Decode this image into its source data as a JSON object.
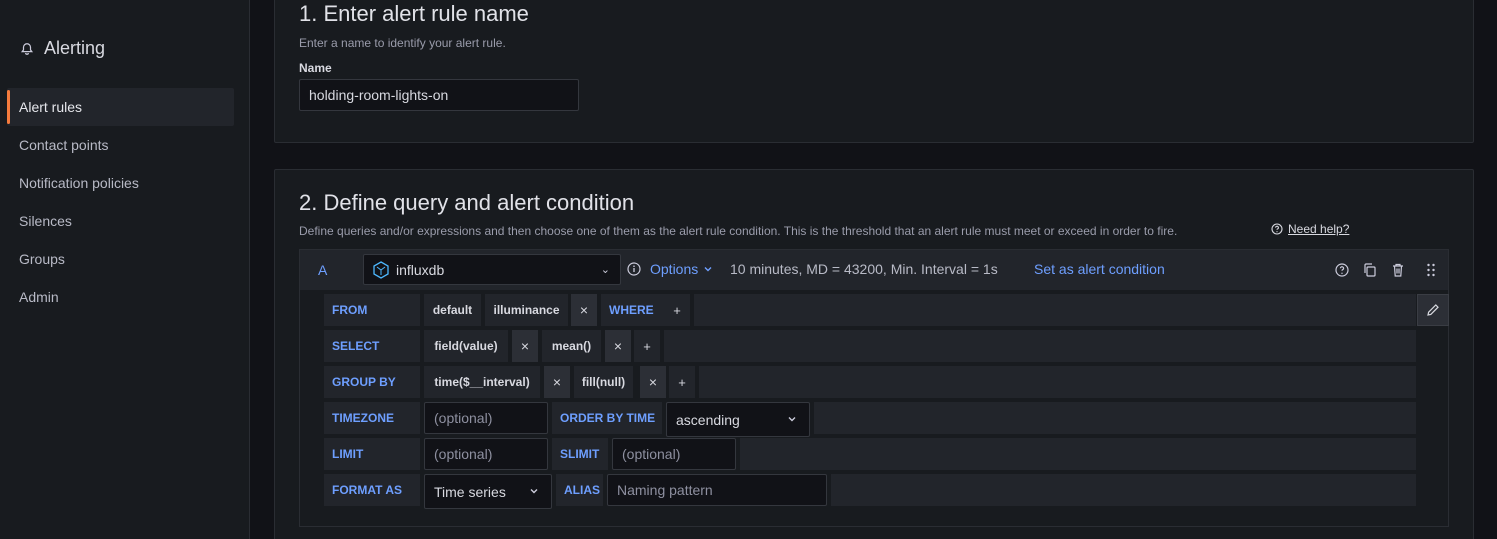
{
  "sidebar": {
    "title": "Alerting",
    "items": [
      {
        "label": "Alert rules",
        "active": true
      },
      {
        "label": "Contact points"
      },
      {
        "label": "Notification policies"
      },
      {
        "label": "Silences"
      },
      {
        "label": "Groups"
      },
      {
        "label": "Admin"
      }
    ]
  },
  "section1": {
    "heading": "1. Enter alert rule name",
    "description": "Enter a name to identify your alert rule.",
    "name_label": "Name",
    "name_value": "holding-room-lights-on"
  },
  "section2": {
    "heading": "2. Define query and alert condition",
    "description": "Define queries and/or expressions and then choose one of them as the alert rule condition. This is the threshold that an alert rule must meet or exceed in order to fire.",
    "help_link": "Need help?",
    "query": {
      "ref_id": "A",
      "datasource": "influxdb",
      "options_label": "Options",
      "options_summary": "10 minutes, MD = 43200, Min. Interval = 1s",
      "set_condition": "Set as alert condition",
      "from": {
        "keyword": "FROM",
        "policy": "default",
        "measurement": "illuminance",
        "where": "WHERE",
        "plus": "+"
      },
      "select": {
        "keyword": "SELECT",
        "field": "field(value)",
        "fn": "mean()",
        "plus": "+"
      },
      "group_by": {
        "keyword": "GROUP BY",
        "time": "time($__interval)",
        "fill": "fill(null)",
        "plus": "+"
      },
      "timezone": {
        "keyword": "TIMEZONE",
        "placeholder": "(optional)",
        "order_keyword": "ORDER BY TIME",
        "order_value": "ascending"
      },
      "limit": {
        "keyword": "LIMIT",
        "placeholder": "(optional)",
        "slimit_keyword": "SLIMIT",
        "slimit_placeholder": "(optional)"
      },
      "format": {
        "keyword": "FORMAT AS",
        "value": "Time series",
        "alias_keyword": "ALIAS",
        "alias_placeholder": "Naming pattern"
      },
      "remove_glyph": "×"
    }
  },
  "colors": {
    "accent": "#6e9fff",
    "active_marker": "#f57b3d"
  }
}
